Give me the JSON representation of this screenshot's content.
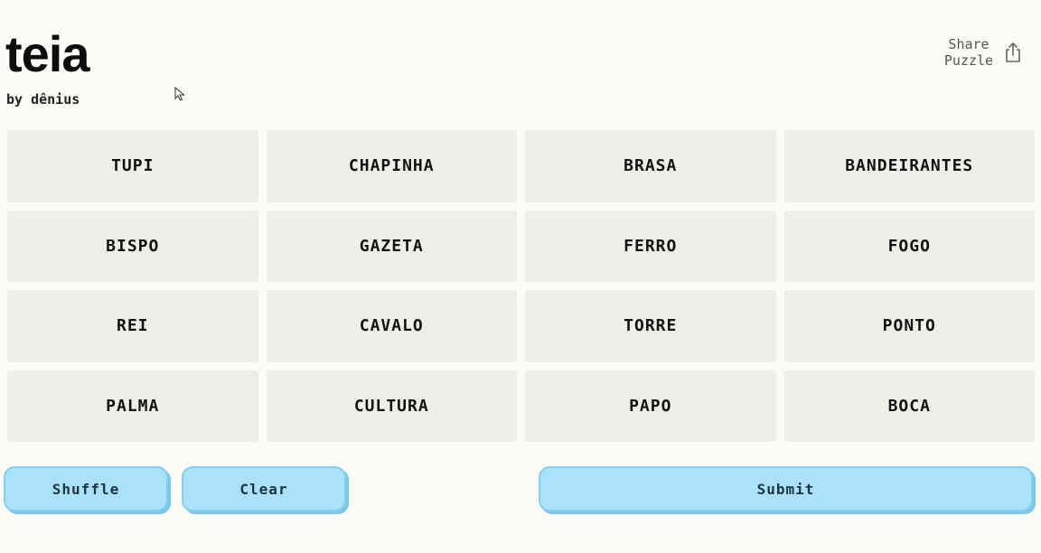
{
  "header": {
    "title": "teia",
    "byline": "by dênius",
    "share_line1": "Share",
    "share_line2": "Puzzle"
  },
  "icons": {
    "share": "share-icon",
    "cursor": "mouse-pointer-icon"
  },
  "tiles": [
    "TUPI",
    "CHAPINHA",
    "BRASA",
    "BANDEIRANTES",
    "BISPO",
    "GAZETA",
    "FERRO",
    "FOGO",
    "REI",
    "CAVALO",
    "TORRE",
    "PONTO",
    "PALMA",
    "CULTURA",
    "PAPO",
    "BOCA"
  ],
  "controls": {
    "shuffle_label": "Shuffle",
    "clear_label": "Clear",
    "submit_label": "Submit"
  },
  "colors": {
    "background": "#fbfbf7",
    "tile": "#efefea",
    "button": "#a9e2fa",
    "button_border": "#86cdee"
  }
}
